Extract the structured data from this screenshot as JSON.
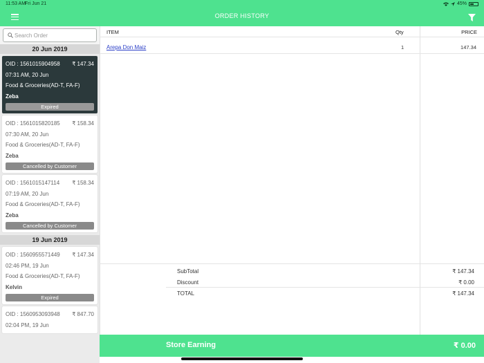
{
  "status_bar": {
    "time": "11:53 AM",
    "date": "Fri Jun 21",
    "battery": "45%"
  },
  "header": {
    "title": "ORDER HISTORY"
  },
  "search": {
    "placeholder": "Search Order"
  },
  "groups": [
    {
      "date": "20 Jun 2019",
      "orders": [
        {
          "oid": "OID : 1561015904958",
          "amount": "₹ 147.34",
          "time": "07:31 AM, 20 Jun",
          "store": "Food & Groceries(AD-T, FA-F)",
          "customer": "Zeba",
          "status": "Expired"
        },
        {
          "oid": "OID : 1561015820185",
          "amount": "₹ 158.34",
          "time": "07:30 AM, 20 Jun",
          "store": "Food & Groceries(AD-T, FA-F)",
          "customer": "Zeba",
          "status": "Cancelled by Customer"
        },
        {
          "oid": "OID : 1561015147114",
          "amount": "₹ 158.34",
          "time": "07:19 AM, 20 Jun",
          "store": "Food & Groceries(AD-T, FA-F)",
          "customer": "Zeba",
          "status": "Cancelled by Customer"
        }
      ]
    },
    {
      "date": "19 Jun 2019",
      "orders": [
        {
          "oid": "OID : 1560955571449",
          "amount": "₹ 147.34",
          "time": "02:46 PM, 19 Jun",
          "store": "Food & Groceries(AD-T, FA-F)",
          "customer": "Kelvin",
          "status": "Expired"
        },
        {
          "oid": "OID : 1560953093948",
          "amount": "₹ 847.70",
          "time": "02:04 PM, 19 Jun",
          "store": "",
          "customer": "",
          "status": ""
        }
      ]
    }
  ],
  "table": {
    "headers": {
      "item": "ITEM",
      "qty": "Qty",
      "price": "PRICE"
    },
    "rows": [
      {
        "item": "Arepa Don Maiz",
        "qty": "1",
        "price": "147.34"
      }
    ]
  },
  "summary": {
    "subtotal_label": "SubTotal",
    "subtotal": "₹ 147.34",
    "discount_label": "Discount",
    "discount": "₹ 0.00",
    "total_label": "TOTAL",
    "total": "₹ 147.34"
  },
  "footer": {
    "label": "Store Earning",
    "value": "₹ 0.00"
  },
  "colors": {
    "accent": "#4ee28f",
    "selected_card": "#2b393b",
    "link": "#2a3ec7"
  },
  "icons": {
    "menu": "hamburger-menu-icon",
    "filter": "filter-funnel-icon",
    "search": "search-icon"
  }
}
